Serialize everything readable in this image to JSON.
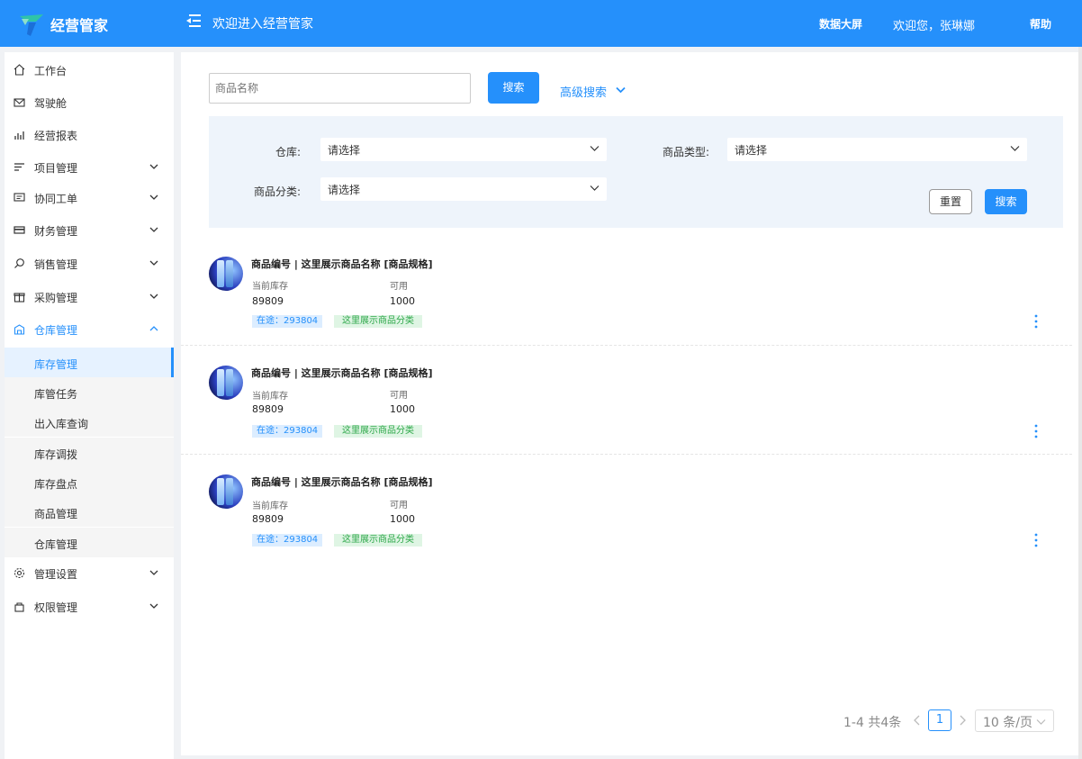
{
  "header": {
    "app_title": "经营管家",
    "welcome": "欢迎进入经营管家",
    "data_screen": "数据大屏",
    "user_greeting": "欢迎您，张琳娜",
    "help": "帮助"
  },
  "sidebar": {
    "items": [
      {
        "label": "工作台",
        "icon": "home-icon"
      },
      {
        "label": "驾驶舱",
        "icon": "mail-icon"
      },
      {
        "label": "经营报表",
        "icon": "report-icon"
      },
      {
        "label": "项目管理",
        "icon": "list-icon"
      },
      {
        "label": "协同工单",
        "icon": "message-icon"
      },
      {
        "label": "财务管理",
        "icon": "card-icon"
      },
      {
        "label": "销售管理",
        "icon": "search-icon"
      },
      {
        "label": "采购管理",
        "icon": "gift-icon"
      },
      {
        "label": "仓库管理",
        "icon": "warehouse-icon"
      },
      {
        "label": "管理设置",
        "icon": "gear-icon"
      },
      {
        "label": "权限管理",
        "icon": "lock-icon"
      }
    ],
    "sub_items": [
      "库存管理",
      "库管任务",
      "出入库查询",
      "库存调拨",
      "库存盘点",
      "商品管理",
      "仓库管理"
    ]
  },
  "search": {
    "placeholder": "商品名称",
    "button": "搜索",
    "advanced": "高级搜索"
  },
  "filters": {
    "warehouse_label": "仓库:",
    "warehouse_value": "请选择",
    "type_label": "商品类型:",
    "type_value": "请选择",
    "category_label": "商品分类:",
    "category_value": "请选择",
    "reset": "重置",
    "search": "搜索"
  },
  "products": [
    {
      "title": "商品编号 | 这里展示商品名称 [商品规格]",
      "stock_label": "当前库存",
      "stock": "89809",
      "avail_label": "可用",
      "avail": "1000",
      "transit": "在途：293804",
      "category": "这里展示商品分类"
    },
    {
      "title": "商品编号 | 这里展示商品名称 [商品规格]",
      "stock_label": "当前库存",
      "stock": "89809",
      "avail_label": "可用",
      "avail": "1000",
      "transit": "在途：293804",
      "category": "这里展示商品分类"
    },
    {
      "title": "商品编号 | 这里展示商品名称 [商品规格]",
      "stock_label": "当前库存",
      "stock": "89809",
      "avail_label": "可用",
      "avail": "1000",
      "transit": "在途：293804",
      "category": "这里展示商品分类"
    }
  ],
  "pagination": {
    "total": "1-4 共4条",
    "current": "1",
    "page_size": "10 条/页"
  },
  "colors": {
    "brand": "#2590fb",
    "tag_blue_bg": "#dcedff",
    "tag_green_bg": "#dff5e4"
  }
}
